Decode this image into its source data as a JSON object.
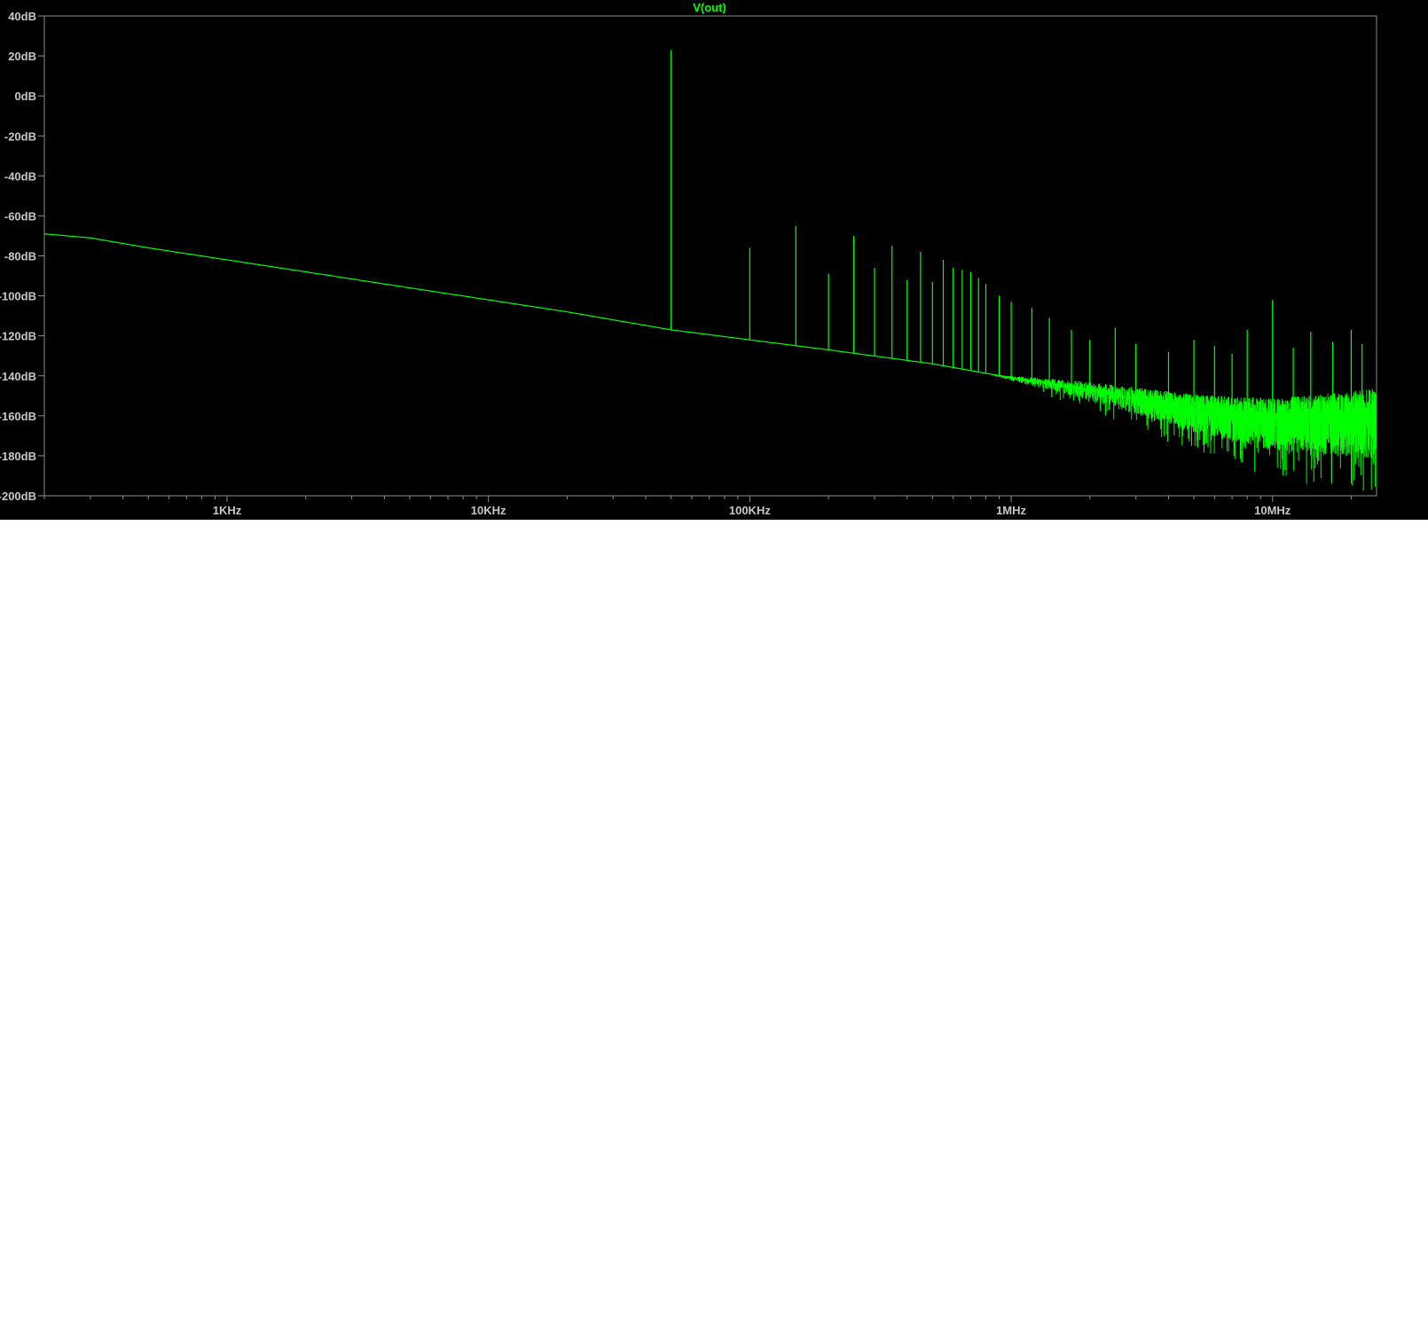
{
  "chart_data": {
    "type": "line",
    "title": "V(out)",
    "x_scale": "log",
    "xlim_hz": [
      200,
      25000000
    ],
    "ylim_db": [
      -200,
      40
    ],
    "y_ticks": [
      {
        "value": 40,
        "label": "40dB"
      },
      {
        "value": 20,
        "label": "20dB"
      },
      {
        "value": 0,
        "label": "0dB"
      },
      {
        "value": -20,
        "label": "-20dB"
      },
      {
        "value": -40,
        "label": "-40dB"
      },
      {
        "value": -60,
        "label": "-60dB"
      },
      {
        "value": -80,
        "label": "-80dB"
      },
      {
        "value": -100,
        "label": "-100dB"
      },
      {
        "value": -120,
        "label": "-120dB"
      },
      {
        "value": -140,
        "label": "-140dB"
      },
      {
        "value": -160,
        "label": "-160dB"
      },
      {
        "value": -180,
        "label": "-180dB"
      },
      {
        "value": -200,
        "label": "-200dB"
      }
    ],
    "x_ticks": [
      {
        "value": 1000,
        "label": "1KHz"
      },
      {
        "value": 10000,
        "label": "10KHz"
      },
      {
        "value": 100000,
        "label": "100KHz"
      },
      {
        "value": 1000000,
        "label": "1MHz"
      },
      {
        "value": 10000000,
        "label": "10MHz"
      }
    ],
    "series": [
      {
        "name": "V(out)",
        "color": "#00ff00",
        "noise_floor": [
          {
            "x": 200,
            "y": -69
          },
          {
            "x": 300,
            "y": -71
          },
          {
            "x": 500,
            "y": -76
          },
          {
            "x": 1000,
            "y": -82
          },
          {
            "x": 2000,
            "y": -88
          },
          {
            "x": 5000,
            "y": -96
          },
          {
            "x": 10000,
            "y": -102
          },
          {
            "x": 20000,
            "y": -108
          },
          {
            "x": 50000,
            "y": -117
          },
          {
            "x": 100000,
            "y": -122
          },
          {
            "x": 200000,
            "y": -127
          },
          {
            "x": 500000,
            "y": -134
          },
          {
            "x": 1000000,
            "y": -141
          },
          {
            "x": 2000000,
            "y": -147
          },
          {
            "x": 5000000,
            "y": -157
          },
          {
            "x": 10000000,
            "y": -162
          },
          {
            "x": 25000000,
            "y": -161
          }
        ],
        "spikes": [
          {
            "x": 50000,
            "y": 23
          },
          {
            "x": 100000,
            "y": -76
          },
          {
            "x": 150000,
            "y": -65
          },
          {
            "x": 200000,
            "y": -89
          },
          {
            "x": 250000,
            "y": -70
          },
          {
            "x": 300000,
            "y": -86
          },
          {
            "x": 350000,
            "y": -75
          },
          {
            "x": 400000,
            "y": -92
          },
          {
            "x": 450000,
            "y": -78
          },
          {
            "x": 500000,
            "y": -93
          },
          {
            "x": 550000,
            "y": -82
          },
          {
            "x": 600000,
            "y": -86
          },
          {
            "x": 650000,
            "y": -87
          },
          {
            "x": 700000,
            "y": -88
          },
          {
            "x": 750000,
            "y": -91
          },
          {
            "x": 800000,
            "y": -94
          },
          {
            "x": 900000,
            "y": -100
          },
          {
            "x": 1000000,
            "y": -103
          },
          {
            "x": 1200000,
            "y": -106
          },
          {
            "x": 1400000,
            "y": -111
          },
          {
            "x": 1700000,
            "y": -117
          },
          {
            "x": 2000000,
            "y": -122
          },
          {
            "x": 2500000,
            "y": -116
          },
          {
            "x": 3000000,
            "y": -124
          },
          {
            "x": 4000000,
            "y": -128
          },
          {
            "x": 5000000,
            "y": -122
          },
          {
            "x": 6000000,
            "y": -125
          },
          {
            "x": 7000000,
            "y": -129
          },
          {
            "x": 8000000,
            "y": -117
          },
          {
            "x": 10000000,
            "y": -102
          },
          {
            "x": 12000000,
            "y": -126
          },
          {
            "x": 14000000,
            "y": -118
          },
          {
            "x": 17000000,
            "y": -123
          },
          {
            "x": 20000000,
            "y": -117
          },
          {
            "x": 22000000,
            "y": -124
          }
        ]
      }
    ]
  }
}
